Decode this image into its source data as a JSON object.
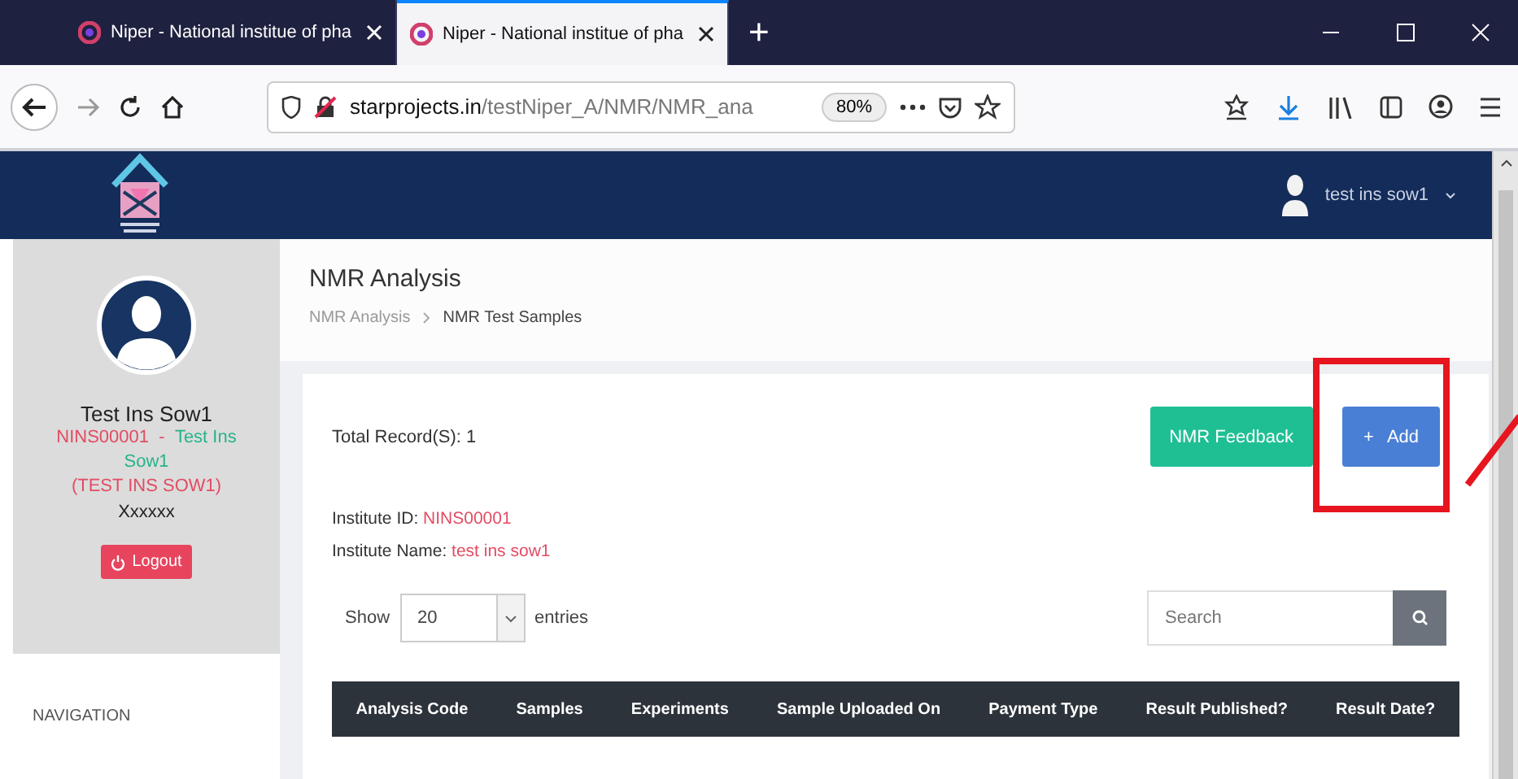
{
  "browser": {
    "tabs": [
      {
        "title": "Niper - National institue of pha",
        "selected": false
      },
      {
        "title": "Niper - National institue of pha",
        "selected": true
      }
    ],
    "new_tab": "+",
    "url_host": "starprojects.in",
    "url_path": "/testNiper_A/NMR/NMR_ana",
    "zoom": "80%"
  },
  "header": {
    "user": "test ins sow1"
  },
  "sidebar": {
    "name": "Test Ins Sow1",
    "code": "NINS00001",
    "separator": "-",
    "institute": "Test Ins Sow1",
    "institute_upper": "(TEST INS SOW1)",
    "role": "Xxxxxx",
    "logout": "Logout",
    "nav_heading": "NAVIGATION"
  },
  "page": {
    "title": "NMR Analysis",
    "breadcrumb": [
      "NMR Analysis",
      "NMR Test Samples"
    ]
  },
  "card": {
    "total": "Total Record(S): 1",
    "buttons": [
      {
        "label": "NMR Feedback",
        "kind": "feedback",
        "highlighted": false
      },
      {
        "label": "Add",
        "kind": "add",
        "icon": "+",
        "highlighted": true
      }
    ],
    "institute_id_label": "Institute ID:",
    "institute_id": "NINS00001",
    "institute_name_label": "Institute Name:",
    "institute_name": "test ins sow1",
    "show_label": "Show",
    "page_size": "20",
    "entries_label": "entries",
    "search_placeholder": "Search",
    "columns": [
      "Analysis Code",
      "Samples",
      "Experiments",
      "Sample Uploaded On",
      "Payment Type",
      "Result Published?",
      "Result Date?"
    ]
  }
}
